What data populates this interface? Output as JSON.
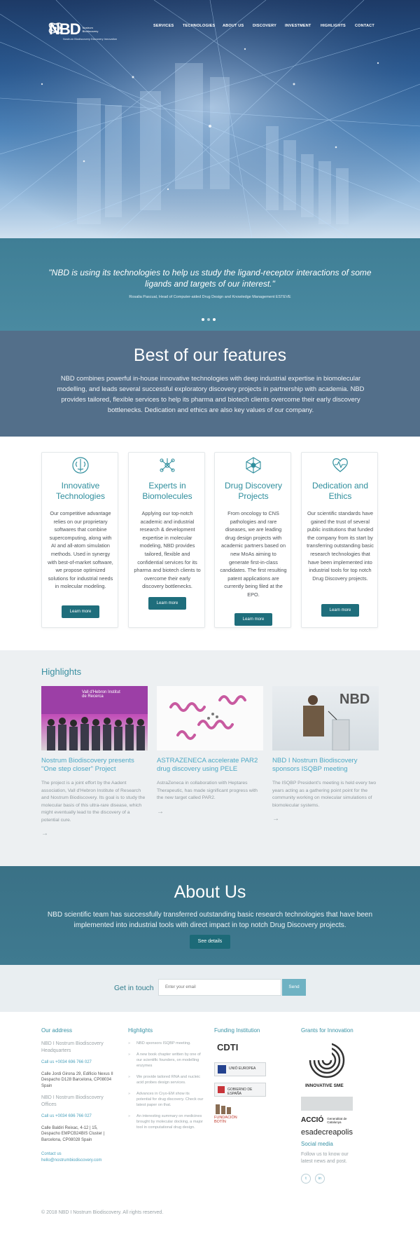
{
  "header": {
    "logo_word": "NBD",
    "logo_sub": "Nostrum Biodiscovery",
    "logo_tagline": "Nostrum Biodiscovery Discovery Innovation",
    "nav": [
      "SERVICES",
      "TECHNOLOGIES",
      "ABOUT US",
      "DISCOVERY",
      "INVESTMENT",
      "HIGHLIGHTS",
      "CONTACT"
    ]
  },
  "quote": {
    "text": "\"NBD is using its technologies to help us study the ligand-receptor interactions of some ligands and targets of our interest.\"",
    "author": "Rosalia Pascual, Head of Computer-aided Drug Design and Knowledge Management ESTEVE",
    "slides": 3,
    "active_slide": 1
  },
  "features": {
    "title": "Best of our features",
    "intro": "NBD combines powerful in-house innovative technologies with deep industrial expertise in biomolecular modelling, and leads several successful exploratory discovery projects in partnership with academia. NBD provides tailored, flexible services to help its pharma and biotech clients overcome their early discovery bottlenecks. Dedication and ethics are also key values of our company.",
    "cards": [
      {
        "icon": "brain-icon",
        "title": "Innovative Technologies",
        "text": "Our competitive advantage relies on our proprietary softwares that combine supercomputing, along with AI and all-atom simulation methods. Used in synergy with best-of-market software, we propose optimized solutions for industrial needs in molecular modeling.",
        "button": "Learn more"
      },
      {
        "icon": "molecule-icon",
        "title": "Experts in Biomolecules",
        "text": "Applying our top-notch academic and industrial research & development expertise in molecular modeling, NBD provides tailored, flexible and confidential services for its pharma and biotech clients to overcome their early discovery bottlenecks.",
        "button": "Learn more"
      },
      {
        "icon": "network-icon",
        "title": "Drug Discovery Projects",
        "text": "From oncology to CNS pathologies and rare diseases, we are leading drug design projects with academic partners based on new MoAs aiming to generate first-in-class candidates. The first resulting patent applications are currently being filed at the EPO.",
        "button": "Learn more"
      },
      {
        "icon": "heart-pulse-icon",
        "title": "Dedication and Ethics",
        "text": "Our scientific standards have gained the trust of several public institutions that funded the company from its start by transferring outstanding basic research technologies that have been implemented into industrial tools for top notch Drug Discovery projects.",
        "button": "Learn more"
      }
    ]
  },
  "highlights": {
    "title": "Highlights",
    "items": [
      {
        "title": "Nostrum Biodiscovery presents \"One step closer\" Project",
        "text": "The project is a joint effort by the Aadent association, Vall d'Hebron Institute of Research and Nostrum Biodiscovery. Its goal is to study the molecular basis of this ultra-rare disease, which might eventually lead to the discovery of a potential cure.",
        "photo_caption": "Vall d'Hebron Institut de Recerca",
        "arrow": "→"
      },
      {
        "title": "ASTRAZENECA accelerate PAR2 drug discovery using PELE",
        "text": "AstraZeneca in collaboration with Heptares Therapeutic, has made significant progress with the new target called PAR2.",
        "arrow": "→"
      },
      {
        "title": "NBD I Nostrum Biodiscovery sponsors ISQBP meeting",
        "text": "The ISQBP President's meeting is held every two years acting as a gathering point point for the community working on molecular simulations of biomolecular systems.",
        "photo_caption": "NBD",
        "arrow": "→"
      }
    ]
  },
  "about": {
    "title": "About Us",
    "text": "NBD scientific team has successfully transferred outstanding basic research technologies that have been implemented into industrial tools with direct impact in top notch Drug Discovery projects.",
    "button": "See details"
  },
  "newsletter": {
    "label": "Get in touch",
    "placeholder": "Enter your email",
    "button": "Send"
  },
  "footer": {
    "address": {
      "title": "Our address",
      "hq_name": "NBD I Nostrum Biodiscovery Headquarters",
      "hq_phone": "Call us +0034 696 766 027",
      "hq_addr": "Calle Jordi Girona 29, Edificio Nexus II Despacho D128 Barcelona, CP08034 Spain",
      "office_name": "NBD I Nostrum Biodiscovery Offices",
      "office_phone": "Call us +0034 696 766 027",
      "office_addr": "Calle Baldiri Reixac, 4-12 | 15, Despacho EMPCB24BIS Cluster | Barcelona, CP08028 Spain",
      "contact_label": "Contact us",
      "email": "hello@nostrumbiodiscovery.com"
    },
    "highlights": {
      "title": "Highlights",
      "items": [
        "NBD sponsors ISQBP meeting.",
        "A new book chapter written by one of our scientific founders, on modelling enzymes",
        "We provide tailored RNA and nucleic acid probes design services.",
        "Advances in Cryo-EM show its potential for drug discovery. Check our latest paper on that.",
        "An interesting summary on medicines brought by molecular docking, a major tool in computational drug design."
      ]
    },
    "funding": {
      "title": "Funding Institution",
      "logos": [
        "CDTI",
        "UNIÓ EUROPEA",
        "GOBIERNO DE ESPAÑA",
        "FUNDACIÓN BOTÍN"
      ]
    },
    "grants": {
      "title": "Grants for Innovation",
      "innovative": "INNOVATIVE SME",
      "accio": "ACCIÓ",
      "generalitat": "Generalitat de Catalunya",
      "esade": "esadecreapolis"
    },
    "social": {
      "title": "Social media",
      "text": "Follow us to know our latest news and post.",
      "twitter": "t",
      "linkedin": "in"
    },
    "copyright": "© 2018 NBD I Nostrum Biodiscovery. All rights reserved."
  }
}
